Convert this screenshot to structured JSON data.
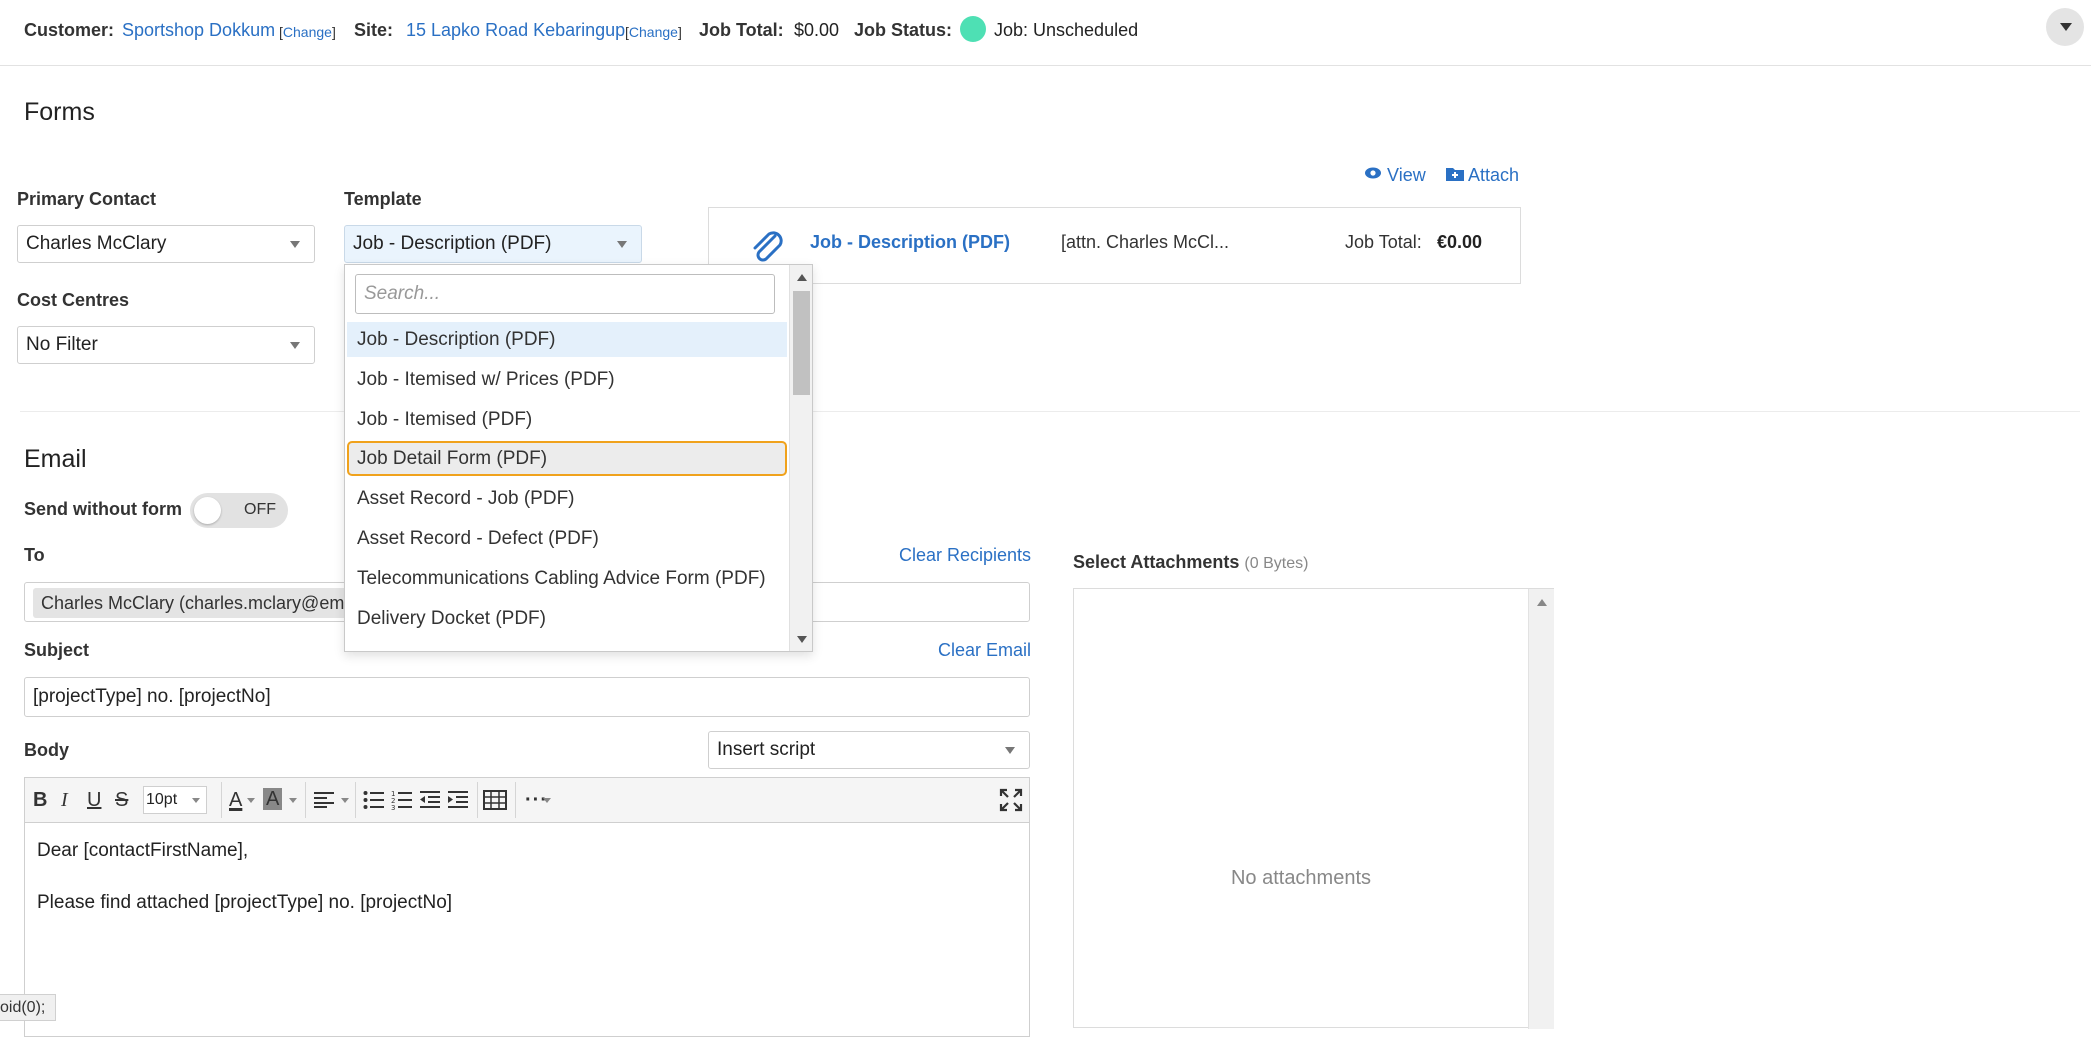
{
  "header": {
    "customer_label": "Customer:",
    "customer_name": "Sportshop Dokkum",
    "customer_change": "Change",
    "site_label": "Site:",
    "site_name": "15 Lapko Road Kebaringup",
    "site_change": "Change",
    "job_total_label": "Job Total:",
    "job_total_value": "$0.00",
    "job_status_label": "Job Status:",
    "job_status_value": "Job: Unscheduled",
    "status_color": "#4ee0b4"
  },
  "forms": {
    "title": "Forms",
    "primary_contact_label": "Primary Contact",
    "primary_contact_value": "Charles McClary",
    "template_label": "Template",
    "template_value": "Job - Description (PDF)",
    "cost_centres_label": "Cost Centres",
    "cost_centres_value": "No Filter",
    "view_label": "View",
    "attach_label": "Attach",
    "preview": {
      "name": "Job - Description (PDF)",
      "attn": "[attn. Charles McCl...",
      "total_label": "Job Total:",
      "total_value": "€0.00"
    }
  },
  "dropdown": {
    "search_placeholder": "Search...",
    "items": [
      "Job - Description (PDF)",
      "Job - Itemised w/ Prices (PDF)",
      "Job - Itemised (PDF)",
      "Job Detail Form (PDF)",
      "Asset Record - Job (PDF)",
      "Asset Record - Defect (PDF)",
      "Telecommunications Cabling Advice Form (PDF)",
      "Delivery Docket (PDF)"
    ],
    "selected_index": 0,
    "hovered_index": 3
  },
  "email": {
    "title": "Email",
    "send_without_form_label": "Send without form",
    "toggle_state": "OFF",
    "to_label": "To",
    "clear_recipients": "Clear Recipients",
    "recipient_chip": "Charles McClary (charles.mclary@ema",
    "subject_label": "Subject",
    "clear_email": "Clear Email",
    "subject_value": "[projectType] no. [projectNo]",
    "body_label": "Body",
    "insert_script": "Insert script",
    "font_size": "10pt",
    "body_lines": [
      "Dear [contactFirstName],",
      "Please find attached [projectType] no. [projectNo]"
    ]
  },
  "attachments": {
    "label": "Select Attachments",
    "size": "(0 Bytes)",
    "empty_text": "No attachments"
  },
  "statusbar": {
    "text": "oid(0);"
  },
  "colors": {
    "link": "#2a70c4",
    "highlight_border": "#f0a21c",
    "selected_bg": "#e4f0fb"
  }
}
